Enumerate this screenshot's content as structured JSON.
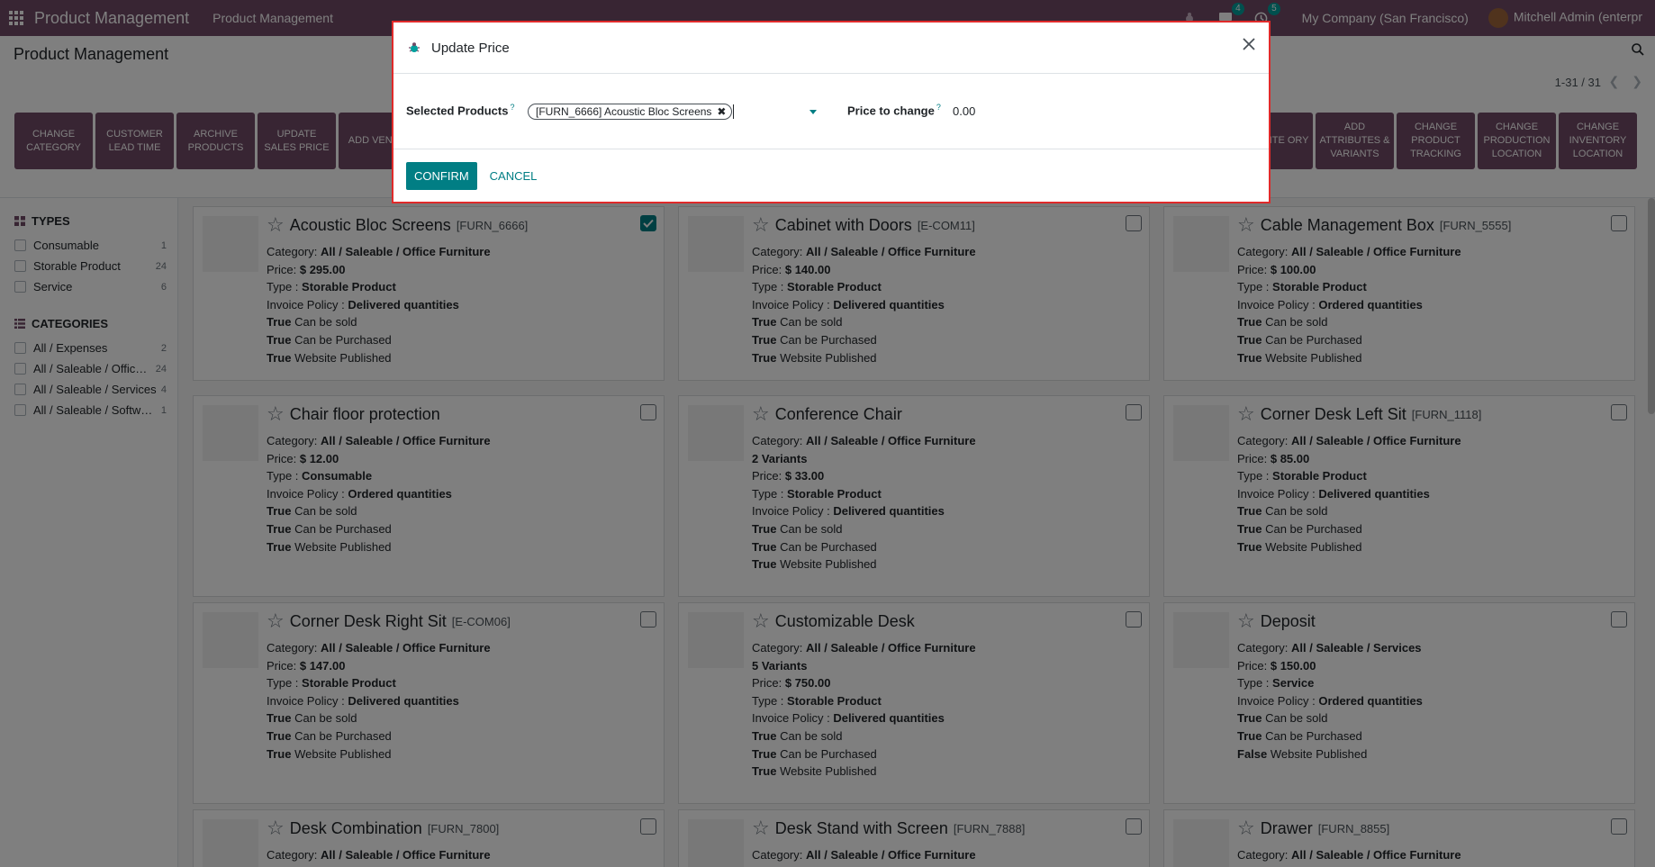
{
  "navbar": {
    "brand": "Product Management",
    "menu": "Product Management",
    "messages_count": "4",
    "activities_count": "5",
    "company": "My Company (San Francisco)",
    "user": "Mitchell Admin (enterpr"
  },
  "control": {
    "title": "Product Management",
    "pager": "1-31 / 31",
    "actions_left": [
      "CHANGE CATEGORY",
      "CUSTOMER LEAD TIME",
      "ARCHIVE PRODUCTS",
      "UPDATE SALES PRICE",
      "ADD VENDO"
    ],
    "actions_right": [
      "NGE SITE ORY",
      "ADD ATTRIBUTES & VARIANTS",
      "CHANGE PRODUCT TRACKING",
      "CHANGE PRODUCTION LOCATION",
      "CHANGE INVENTORY LOCATION"
    ]
  },
  "sidebar": {
    "types_title": "TYPES",
    "types": [
      {
        "label": "Consumable",
        "count": "1"
      },
      {
        "label": "Storable Product",
        "count": "24"
      },
      {
        "label": "Service",
        "count": "6"
      }
    ],
    "categories_title": "CATEGORIES",
    "categories": [
      {
        "label": "All / Expenses",
        "count": "2"
      },
      {
        "label": "All / Saleable / Office Furniture",
        "count": "24"
      },
      {
        "label": "All / Saleable / Services",
        "count": "4"
      },
      {
        "label": "All / Saleable / Software",
        "count": "1"
      }
    ]
  },
  "cards": [
    {
      "title": "Acoustic Bloc Screens",
      "ref": "[FURN_6666]",
      "category": "All / Saleable / Office Furniture",
      "variants": "",
      "price": "$ 295.00",
      "type": "Storable Product",
      "policy": "Delivered quantities",
      "sold": "True",
      "purchased": "True",
      "published": "True",
      "checked": true
    },
    {
      "title": "Cabinet with Doors",
      "ref": "[E-COM11]",
      "category": "All / Saleable / Office Furniture",
      "variants": "",
      "price": "$ 140.00",
      "type": "Storable Product",
      "policy": "Delivered quantities",
      "sold": "True",
      "purchased": "True",
      "published": "True",
      "checked": false
    },
    {
      "title": "Cable Management Box",
      "ref": "[FURN_5555]",
      "category": "All / Saleable / Office Furniture",
      "variants": "",
      "price": "$ 100.00",
      "type": "Storable Product",
      "policy": "Ordered quantities",
      "sold": "True",
      "purchased": "True",
      "published": "True",
      "checked": false
    },
    {
      "title": "Chair floor protection",
      "ref": "",
      "category": "All / Saleable / Office Furniture",
      "variants": "",
      "price": "$ 12.00",
      "type": "Consumable",
      "policy": "Ordered quantities",
      "sold": "True",
      "purchased": "True",
      "published": "True",
      "checked": false
    },
    {
      "title": "Conference Chair",
      "ref": "",
      "category": "All / Saleable / Office Furniture",
      "variants": "2 Variants",
      "price": "$ 33.00",
      "type": "Storable Product",
      "policy": "Delivered quantities",
      "sold": "True",
      "purchased": "True",
      "published": "True",
      "checked": false
    },
    {
      "title": "Corner Desk Left Sit",
      "ref": "[FURN_1118]",
      "category": "All / Saleable / Office Furniture",
      "variants": "",
      "price": "$ 85.00",
      "type": "Storable Product",
      "policy": "Delivered quantities",
      "sold": "True",
      "purchased": "True",
      "published": "True",
      "checked": false
    },
    {
      "title": "Corner Desk Right Sit",
      "ref": "[E-COM06]",
      "category": "All / Saleable / Office Furniture",
      "variants": "",
      "price": "$ 147.00",
      "type": "Storable Product",
      "policy": "Delivered quantities",
      "sold": "True",
      "purchased": "True",
      "published": "True",
      "checked": false
    },
    {
      "title": "Customizable Desk",
      "ref": "",
      "category": "All / Saleable / Office Furniture",
      "variants": "5 Variants",
      "price": "$ 750.00",
      "type": "Storable Product",
      "policy": "Delivered quantities",
      "sold": "True",
      "purchased": "True",
      "published": "True",
      "checked": false
    },
    {
      "title": "Deposit",
      "ref": "",
      "category": "All / Saleable / Services",
      "variants": "",
      "price": "$ 150.00",
      "type": "Service",
      "policy": "Ordered quantities",
      "sold": "True",
      "purchased": "True",
      "published": "False",
      "checked": false
    },
    {
      "title": "Desk Combination",
      "ref": "[FURN_7800]",
      "category": "All / Saleable / Office Furniture",
      "variants": "",
      "price": "",
      "type": "",
      "policy": "",
      "sold": "",
      "purchased": "",
      "published": "",
      "checked": false
    },
    {
      "title": "Desk Stand with Screen",
      "ref": "[FURN_7888]",
      "category": "All / Saleable / Office Furniture",
      "variants": "",
      "price": "",
      "type": "",
      "policy": "",
      "sold": "",
      "purchased": "",
      "published": "",
      "checked": false
    },
    {
      "title": "Drawer",
      "ref": "[FURN_8855]",
      "category": "All / Saleable / Office Furniture",
      "variants": "",
      "price": "",
      "type": "",
      "policy": "",
      "sold": "",
      "purchased": "",
      "published": "",
      "checked": false
    }
  ],
  "labels": {
    "category": "Category:",
    "price": "Price:",
    "type": "Type :",
    "policy": "Invoice Policy :",
    "sold": "Can be sold",
    "purchased": "Can be Purchased",
    "published": "Website Published"
  },
  "modal": {
    "title": "Update Price",
    "selected_label": "Selected Products",
    "selected_tag": "[FURN_6666] Acoustic Bloc Screens",
    "price_label": "Price to change",
    "price_value": "0.00",
    "help_mark": "?",
    "confirm": "CONFIRM",
    "cancel": "CANCEL"
  },
  "colors": {
    "brand": "#714b67",
    "accent": "#017e84"
  }
}
